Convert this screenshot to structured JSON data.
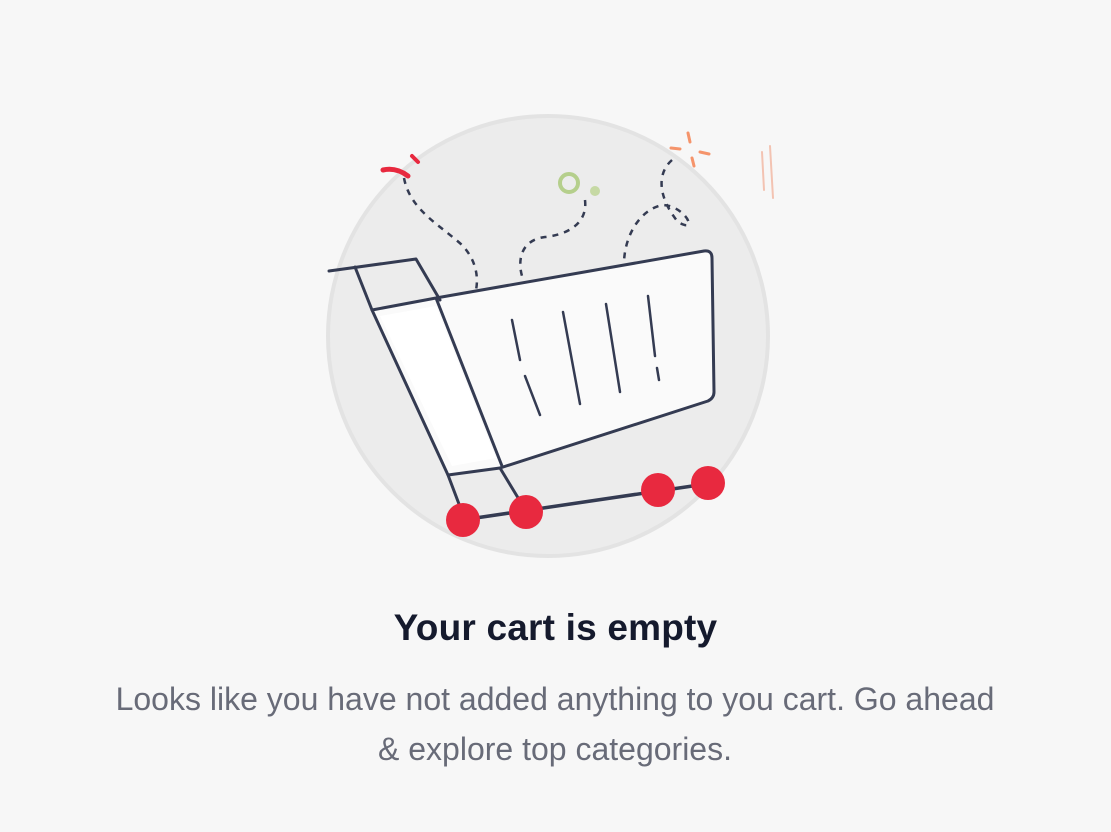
{
  "empty_state": {
    "title": "Your cart is empty",
    "message": "Looks like you have not added anything to you cart. Go ahead & explore top categories.",
    "illustration_icon": "empty-shopping-cart-icon"
  },
  "colors": {
    "background": "#f7f7f7",
    "title": "#151a2d",
    "message": "#686b78",
    "accent_red": "#e8293f",
    "outline": "#343b52",
    "accent_green": "#b5cf8c",
    "accent_orange": "#f5946b"
  }
}
